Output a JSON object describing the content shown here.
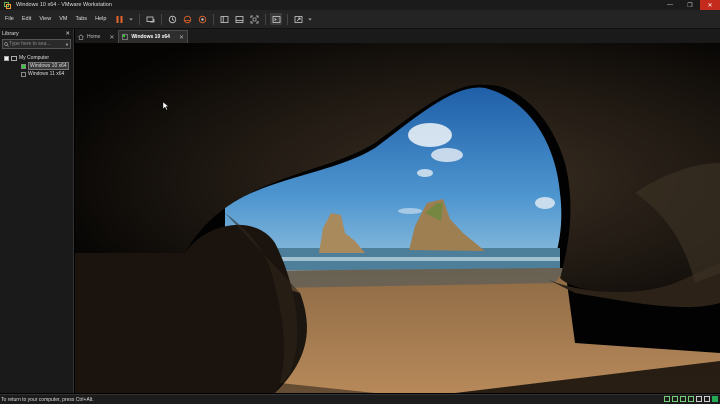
{
  "window": {
    "title": "Windows 10 x64 - VMware Workstation",
    "minimize_glyph": "—",
    "maximize_glyph": "❐",
    "close_glyph": "✕"
  },
  "menu": {
    "file": "File",
    "edit": "Edit",
    "view": "View",
    "vm": "VM",
    "tabs": "Tabs",
    "help": "Help"
  },
  "toolbar": {
    "icons": [
      "pause-icon",
      "send-ctrl-alt-del-icon",
      "snapshot-icon",
      "revert-snapshot-icon",
      "manage-snapshots-icon",
      "library-view-icon",
      "thumbnail-bar-icon",
      "full-screen-icon",
      "console-view-icon",
      "unity-icon"
    ],
    "accent": "#e8642a"
  },
  "library": {
    "title": "Library",
    "close_glyph": "✕",
    "search_placeholder": "Type here to sea...",
    "tree": {
      "root": "My Computer",
      "items": [
        {
          "label": "Windows 10 x64",
          "selected": true,
          "running": true
        },
        {
          "label": "Windows 11 x64",
          "selected": false,
          "running": false
        }
      ]
    }
  },
  "tabs": [
    {
      "label": "Home",
      "icon": "home-icon"
    },
    {
      "label": "Windows 10 x64",
      "icon": "vm-tab-icon",
      "active": true
    }
  ],
  "status": {
    "message": "To return to your computer, press Ctrl+Alt."
  }
}
